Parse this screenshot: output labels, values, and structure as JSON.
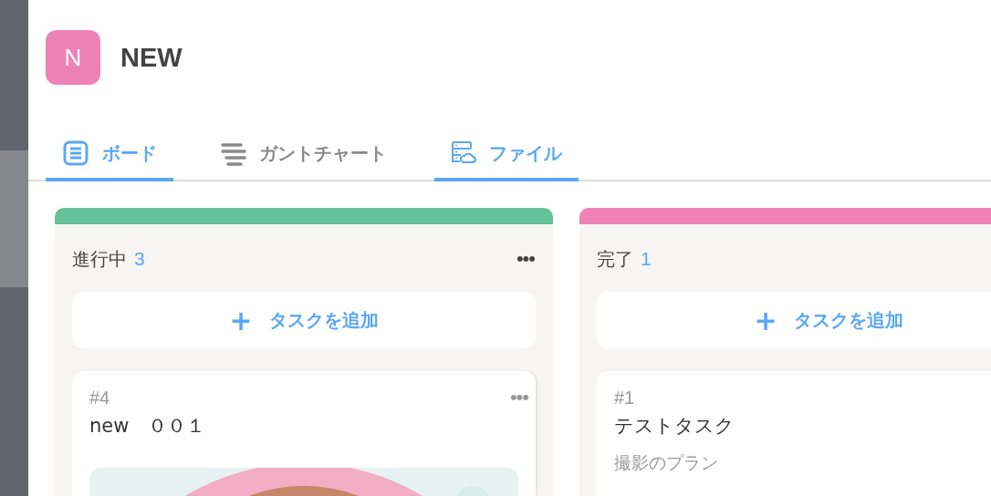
{
  "project": {
    "initial": "N",
    "name": "NEW"
  },
  "tabs": [
    {
      "label": "ボード",
      "kind": "board",
      "selected": true
    },
    {
      "label": "ガントチャート",
      "kind": "gantt",
      "selected": false
    },
    {
      "label": "ファイル",
      "kind": "files",
      "selected": true
    }
  ],
  "columns": [
    {
      "title": "進行中",
      "count": "3",
      "color": "#64c199",
      "menu": "•••",
      "add_label": "タスクを追加",
      "add_icon": "+",
      "cards": [
        {
          "number": "#4",
          "title": "new　００１",
          "menu": "•••",
          "kind": "picture"
        }
      ]
    },
    {
      "title": "完了",
      "count": "1",
      "color": "#ee82b6",
      "add_label": "タスクを追加",
      "add_icon": "+",
      "cards": [
        {
          "number": "#1",
          "title": "テストタスク",
          "subtitle": "撮影のプラン",
          "kind": "text"
        }
      ]
    }
  ]
}
